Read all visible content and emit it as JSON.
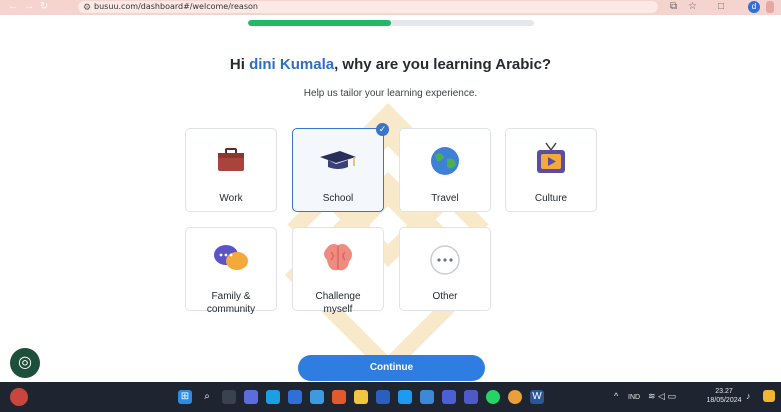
{
  "browser": {
    "url": "busuu.com/dashboard#/welcome/reason",
    "profile_initial": "d"
  },
  "progress": {
    "fraction": 0.5
  },
  "heading": {
    "prefix": "Hi ",
    "name": "dini Kumala",
    "suffix": ", why are you learning Arabic?"
  },
  "subtitle": "Help us tailor your learning experience.",
  "options": [
    {
      "label": "Work",
      "icon": "briefcase-icon",
      "selected": false
    },
    {
      "label": "School",
      "icon": "graduation-cap-icon",
      "selected": true
    },
    {
      "label": "Travel",
      "icon": "globe-icon",
      "selected": false
    },
    {
      "label": "Culture",
      "icon": "tv-icon",
      "selected": false
    },
    {
      "label_line1": "Family &",
      "label_line2": "community",
      "icon": "chat-bubbles-icon",
      "selected": false
    },
    {
      "label_line1": "Challenge",
      "label_line2": "myself",
      "icon": "brain-icon",
      "selected": false
    },
    {
      "label": "Other",
      "icon": "more-dots-icon",
      "selected": false
    }
  ],
  "continue_label": "Continue",
  "taskbar": {
    "lang": "IND",
    "time": "23.27",
    "date": "18/05/2024"
  },
  "colors": {
    "accent_blue": "#2f7de0",
    "progress_green": "#23b768",
    "name_blue": "#2e6ec8",
    "browser_bar": "#f5d3cf",
    "taskbar": "#1e2430"
  }
}
